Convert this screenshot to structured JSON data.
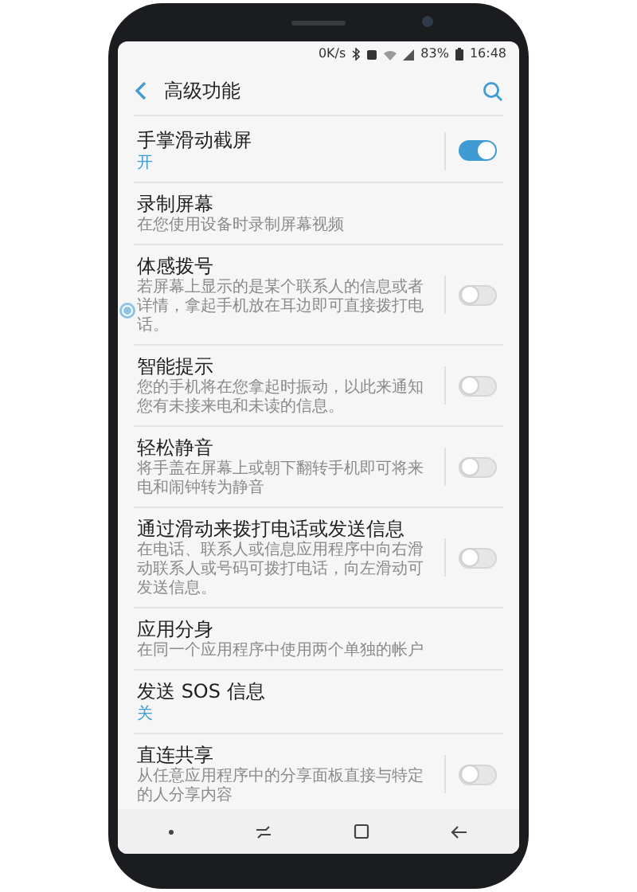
{
  "status_bar": {
    "network_speed": "0K/s",
    "battery": "83%",
    "time": "16:48"
  },
  "header": {
    "title": "高级功能"
  },
  "settings": [
    {
      "kind": "toggle",
      "title": "手掌滑动截屏",
      "status": "开",
      "on": true
    },
    {
      "kind": "link",
      "title": "录制屏幕",
      "subtitle": "在您使用设备时录制屏幕视频"
    },
    {
      "kind": "toggle",
      "title": "体感拨号",
      "subtitle": "若屏幕上显示的是某个联系人的信息或者详情，拿起手机放在耳边即可直接拨打电话。",
      "on": false
    },
    {
      "kind": "toggle",
      "title": "智能提示",
      "subtitle": "您的手机将在您拿起时振动，以此来通知您有未接来电和未读的信息。",
      "on": false
    },
    {
      "kind": "toggle",
      "title": "轻松静音",
      "subtitle": "将手盖在屏幕上或朝下翻转手机即可将来电和闹钟转为静音",
      "on": false
    },
    {
      "kind": "toggle",
      "title": "通过滑动来拨打电话或发送信息",
      "subtitle": "在电话、联系人或信息应用程序中向右滑动联系人或号码可拨打电话，向左滑动可发送信息。",
      "on": false
    },
    {
      "kind": "link",
      "title": "应用分身",
      "subtitle": "在同一个应用程序中使用两个单独的帐户"
    },
    {
      "kind": "link",
      "title": "发送 SOS 信息",
      "status": "关"
    },
    {
      "kind": "toggle",
      "title": "直连共享",
      "subtitle": "从任意应用程序中的分享面板直接与特定的人分享内容",
      "on": false
    }
  ]
}
